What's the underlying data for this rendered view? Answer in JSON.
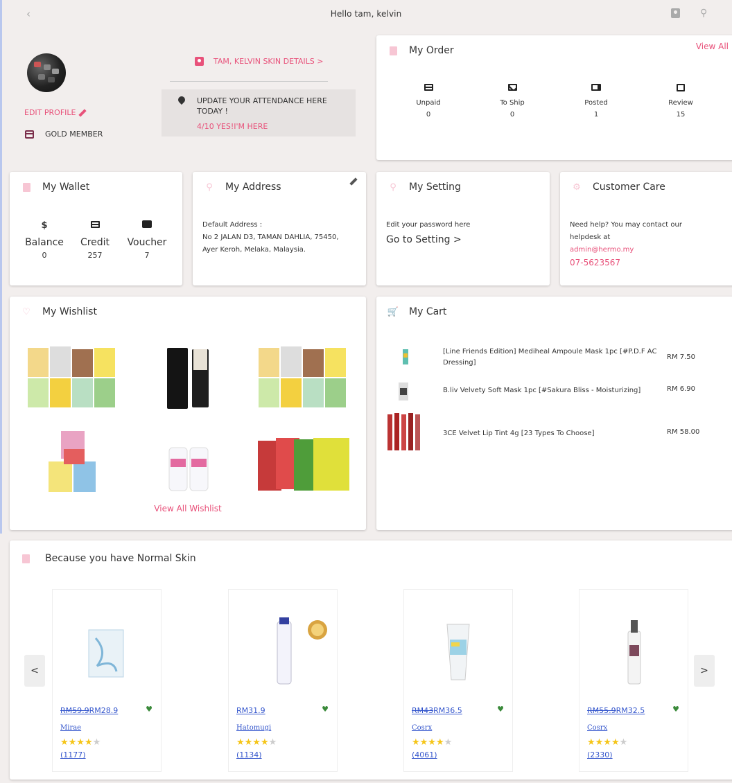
{
  "topbar": {
    "greeting": "Hello tam, kelvin",
    "back_icon": "chevron-left-icon",
    "icons": [
      "id-card-icon",
      "location-pin-icon"
    ]
  },
  "profile": {
    "edit_label": "EDIT PROFILE",
    "membership": "GOLD MEMBER",
    "skin_details_link": "TAM, KELVIN SKIN DETAILS >",
    "attendance_line": "UPDATE YOUR ATTENDANCE HERE TODAY !",
    "attendance_status": "4/10 YES!I'M HERE"
  },
  "order": {
    "title": "My Order",
    "view_all": "View All",
    "items": [
      {
        "label": "Unpaid",
        "count": "0",
        "icon": "card-icon"
      },
      {
        "label": "To Ship",
        "count": "0",
        "icon": "mail-icon"
      },
      {
        "label": "Posted",
        "count": "1",
        "icon": "truck-icon"
      },
      {
        "label": "Review",
        "count": "15",
        "icon": "chat-icon"
      }
    ]
  },
  "wallet": {
    "title": "My Wallet",
    "items": [
      {
        "label": "Balance",
        "value": "0",
        "icon": "$"
      },
      {
        "label": "Credit",
        "value": "257",
        "icon": "card-icon"
      },
      {
        "label": "Voucher",
        "value": "7",
        "icon": "ticket-icon"
      }
    ]
  },
  "address": {
    "title": "My Address",
    "label": "Default Address :",
    "line1": "No 2 JALAN D3, TAMAN DAHLIA, 75450,",
    "line2": "Ayer Keroh, Melaka, Malaysia."
  },
  "setting": {
    "title": "My Setting",
    "hint": "Edit your password here",
    "link": "Go to Setting >"
  },
  "care": {
    "title": "Customer Care",
    "line1": "Need help? You may contact our",
    "line2": "helpdesk at",
    "email": "admin@hermo.my",
    "phone": "07-5623567"
  },
  "wishlist": {
    "title": "My Wishlist",
    "view_all": "View All Wishlist"
  },
  "cart": {
    "title": "My Cart",
    "items": [
      {
        "name": "[Line Friends Edition] Mediheal Ampoule Mask 1pc [#P.D.F AC Dressing]",
        "price": "RM 7.50"
      },
      {
        "name": "B.liv Velvety Soft Mask 1pc [#Sakura Bliss - Moisturizing]",
        "price": "RM 6.90"
      },
      {
        "name": "3CE Velvet Lip Tint 4g [23 Types To Choose]",
        "price": "RM 58.00"
      }
    ]
  },
  "recommend": {
    "title": "Because you have Normal Skin",
    "prev": "<",
    "next": ">",
    "products": [
      {
        "old_price": "RM59.9",
        "price": "RM28.9",
        "brand": "Mirae",
        "rating": 4,
        "reviews": "(1177)"
      },
      {
        "old_price": "",
        "price": "RM31.9",
        "brand": "Hatomugi",
        "rating": 4,
        "reviews": "(1134)"
      },
      {
        "old_price": "RM43",
        "price": "RM36.5",
        "brand": "Cosrx",
        "rating": 4,
        "reviews": "(4061)"
      },
      {
        "old_price": "RM55.9",
        "price": "RM32.5",
        "brand": "Cosrx",
        "rating": 4,
        "reviews": "(2330)"
      }
    ]
  },
  "colors": {
    "accent": "#e8517a",
    "background": "#f2eeed",
    "link": "#3355cc",
    "star": "#f5c518",
    "heart": "#3a8a3a"
  }
}
